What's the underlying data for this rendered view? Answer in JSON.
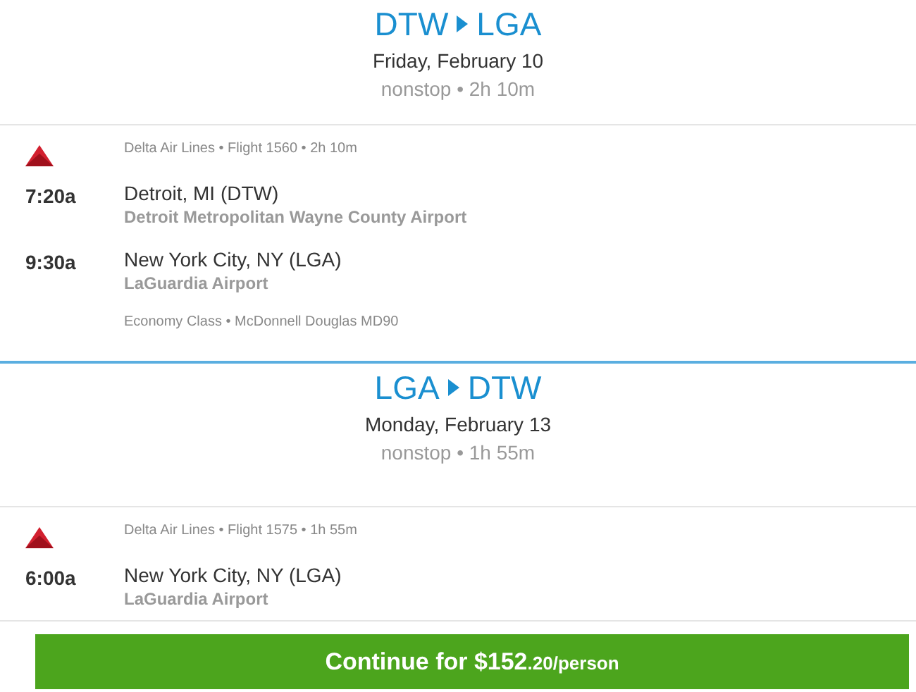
{
  "legs": [
    {
      "origin": "DTW",
      "destination": "LGA",
      "date": "Friday, February 10",
      "summary": "nonstop • 2h 10m",
      "flights": [
        {
          "meta": "Delta Air Lines • Flight 1560 • 2h 10m",
          "stops": [
            {
              "time": "7:20a",
              "city": "Detroit, MI (DTW)",
              "airport": "Detroit Metropolitan Wayne County Airport"
            },
            {
              "time": "9:30a",
              "city": "New York City, NY (LGA)",
              "airport": "LaGuardia Airport"
            }
          ],
          "details": "Economy Class • McDonnell Douglas MD90"
        }
      ]
    },
    {
      "origin": "LGA",
      "destination": "DTW",
      "date": "Monday, February 13",
      "summary": "nonstop • 1h 55m",
      "flights": [
        {
          "meta": "Delta Air Lines • Flight 1575 • 1h 55m",
          "stops": [
            {
              "time": "6:00a",
              "city": "New York City, NY (LGA)",
              "airport": "LaGuardia Airport"
            }
          ]
        }
      ]
    }
  ],
  "continue_button": {
    "label": "Continue for $152",
    "suffix": ".20/person"
  }
}
